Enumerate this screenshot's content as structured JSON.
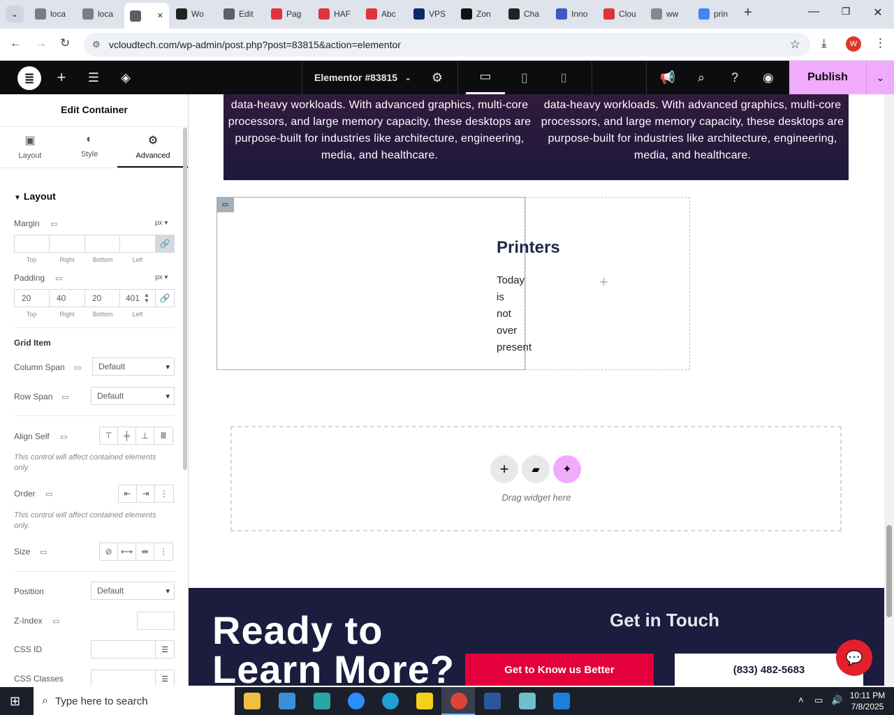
{
  "browser": {
    "tabs": [
      {
        "label": "loca",
        "color": "#7a7f87"
      },
      {
        "label": "loca",
        "color": "#7a7f87"
      },
      {
        "label": "",
        "color": "#5b5f66",
        "active": true
      },
      {
        "label": "Wo",
        "color": "#222"
      },
      {
        "label": "Edit",
        "color": "#5b5f66"
      },
      {
        "label": "Pag",
        "color": "#e0323c"
      },
      {
        "label": "HAF",
        "color": "#e0323c"
      },
      {
        "label": "Abc",
        "color": "#e0323c"
      },
      {
        "label": "VPS",
        "color": "#0b2a6b"
      },
      {
        "label": "Zon",
        "color": "#111"
      },
      {
        "label": "Cha",
        "color": "#222"
      },
      {
        "label": "Inno",
        "color": "#3e57c4"
      },
      {
        "label": "Clou",
        "color": "#d33"
      },
      {
        "label": "ww",
        "color": "#888"
      },
      {
        "label": "prin",
        "color": "#4285f4"
      }
    ],
    "url": "vcloudtech.com/wp-admin/post.php?post=83815&action=elementor",
    "profile_initial": "W"
  },
  "elementor": {
    "doc_title": "Elementor #83815",
    "publish_label": "Publish"
  },
  "panel": {
    "title": "Edit Container",
    "tabs": {
      "layout": "Layout",
      "style": "Style",
      "advanced": "Advanced"
    },
    "section_layout": "Layout",
    "margin": {
      "label": "Margin",
      "unit": "px",
      "top": "",
      "right": "",
      "bottom": "",
      "left": ""
    },
    "padding": {
      "label": "Padding",
      "unit": "px",
      "top": "20",
      "right": "40",
      "bottom": "20",
      "left": "401"
    },
    "sides": {
      "top": "Top",
      "right": "Right",
      "bottom": "Bottom",
      "left": "Left"
    },
    "grid_item": "Grid Item",
    "column_span": {
      "label": "Column Span",
      "value": "Default"
    },
    "row_span": {
      "label": "Row Span",
      "value": "Default"
    },
    "align_self": "Align Self",
    "note": "This control will affect contained elements only.",
    "order": "Order",
    "size": "Size",
    "position": {
      "label": "Position",
      "value": "Default"
    },
    "zindex": "Z-Index",
    "css_id": "CSS ID",
    "css_classes": "CSS Classes"
  },
  "canvas": {
    "dark_text_left": [
      "data-heavy workloads. With advanced graphics, multi-core",
      "processors, and large memory capacity, these desktops are",
      "purpose-built for industries like architecture, engineering,",
      "media, and healthcare."
    ],
    "dark_text_right": [
      "data-heavy workloads. With advanced graphics, multi-core",
      "processors, and large memory capacity, these desktops are",
      "purpose-built for industries like architecture, engineering,",
      "media, and healthcare."
    ],
    "printers_heading": "Printers",
    "printers_words": [
      "Today",
      "is",
      "not",
      "over",
      "present"
    ],
    "drag_widget": "Drag widget here",
    "footer": {
      "heading_line1": "Ready to",
      "heading_line2": "Learn More?",
      "get_in_touch": "Get in Touch",
      "cta_red": "Get to Know us Better",
      "cta_phone": "(833) 482-5683"
    }
  },
  "taskbar": {
    "search_placeholder": "Type here to search",
    "time": "10:11 PM",
    "date": "7/8/2025"
  }
}
